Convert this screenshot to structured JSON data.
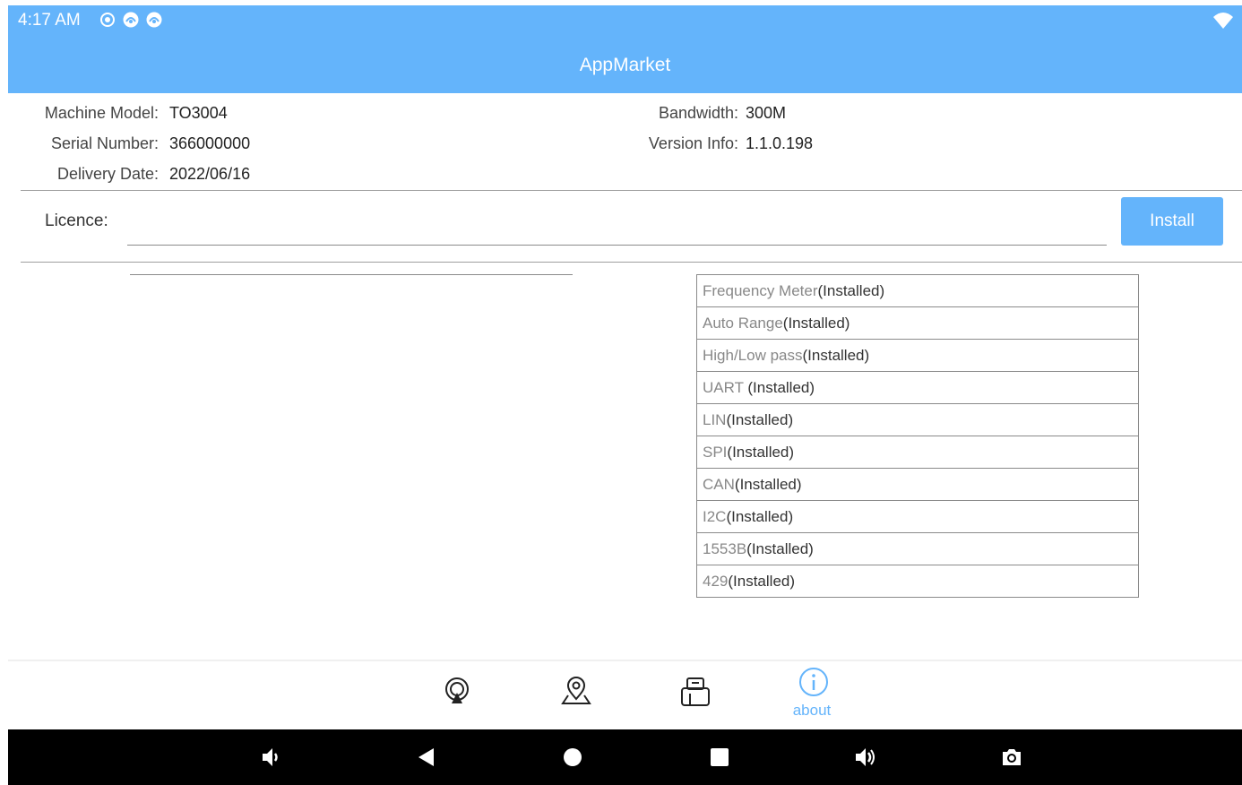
{
  "status_bar": {
    "time": "4:17 AM",
    "icons": [
      "radio-button-icon",
      "notification-app-icon",
      "notification-app-icon"
    ],
    "wifi": "wifi-icon"
  },
  "app_bar": {
    "title": "AppMarket"
  },
  "info": {
    "machine_model": {
      "label": "Machine Model:",
      "value": "TO3004"
    },
    "serial_number": {
      "label": "Serial Number:",
      "value": "366000000"
    },
    "delivery_date": {
      "label": "Delivery Date:",
      "value": "2022/06/16"
    },
    "bandwidth": {
      "label": "Bandwidth:",
      "value": "300M"
    },
    "version_info": {
      "label": "Version Info:",
      "value": "1.1.0.198"
    }
  },
  "licence": {
    "label": "Licence:",
    "value": "",
    "install_label": "Install"
  },
  "plugins": [
    {
      "name": "Frequency Meter",
      "status": "(Installed)"
    },
    {
      "name": "Auto Range",
      "status": "(Installed)"
    },
    {
      "name": "High/Low pass",
      "status": "(Installed)"
    },
    {
      "name": "UART ",
      "status": "(Installed)"
    },
    {
      "name": "LIN",
      "status": "(Installed)"
    },
    {
      "name": "SPI",
      "status": "(Installed)"
    },
    {
      "name": "CAN",
      "status": "(Installed)"
    },
    {
      "name": "I2C",
      "status": "(Installed)"
    },
    {
      "name": "1553B",
      "status": "(Installed)"
    },
    {
      "name": "429",
      "status": "(Installed)"
    }
  ],
  "tabs": [
    {
      "icon": "broadcast-icon",
      "label": ""
    },
    {
      "icon": "location-pin-icon",
      "label": ""
    },
    {
      "icon": "usb-drive-icon",
      "label": ""
    },
    {
      "icon": "info-icon",
      "label": "about",
      "active": true
    }
  ],
  "colors": {
    "accent": "#64b4fb",
    "nav_bar": "#000000",
    "muted_text": "#888888"
  },
  "system_nav": [
    "volume-down-icon",
    "back-icon",
    "home-icon",
    "recents-icon",
    "volume-up-icon",
    "screenshot-icon"
  ]
}
